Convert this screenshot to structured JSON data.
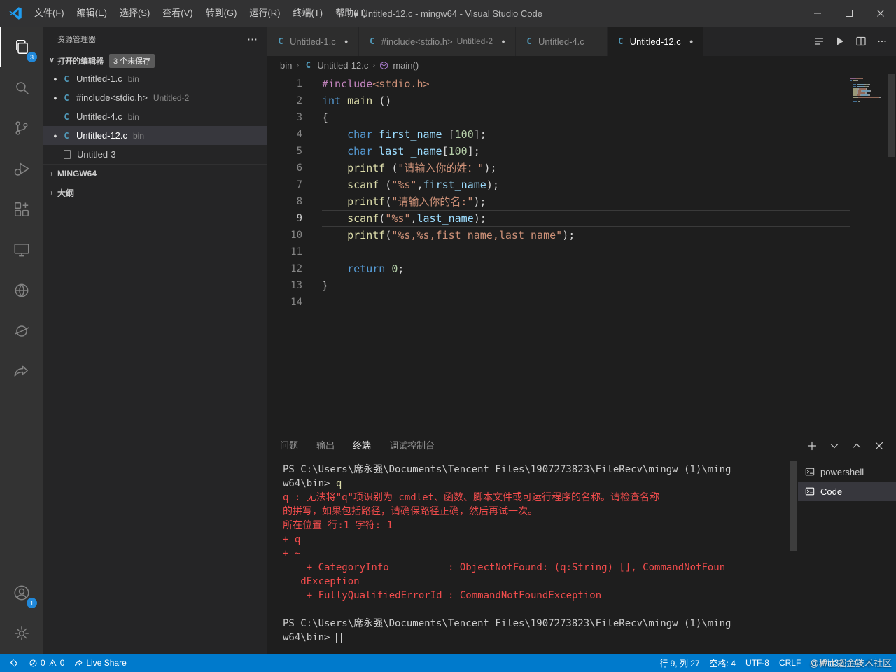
{
  "titlebar": {
    "menus": [
      "文件(F)",
      "编辑(E)",
      "选择(S)",
      "查看(V)",
      "转到(G)",
      "运行(R)",
      "终端(T)",
      "帮助(H)"
    ],
    "title": "● Untitled-12.c - mingw64 - Visual Studio Code"
  },
  "activity": {
    "explorer_badge": "3",
    "account_badge": "1"
  },
  "icons": {
    "modified_dot": "●",
    "chevron_down": "∨",
    "chevron_right": "›",
    "ellipsis": "⋯",
    "c_file": "C"
  },
  "sidebar": {
    "header": "资源管理器",
    "open_editors": {
      "label": "打开的编辑器",
      "badge": "3 个未保存"
    },
    "files": [
      {
        "modified": true,
        "icon": "c",
        "name": "Untitled-1.c",
        "detail": "bin",
        "selected": false
      },
      {
        "modified": true,
        "icon": "c",
        "name": "#include<stdio.h>",
        "detail": "Untitled-2",
        "selected": false
      },
      {
        "modified": false,
        "icon": "c",
        "name": "Untitled-4.c",
        "detail": "bin",
        "selected": false
      },
      {
        "modified": true,
        "icon": "c",
        "name": "Untitled-12.c",
        "detail": "bin",
        "selected": true
      },
      {
        "modified": false,
        "icon": "file",
        "name": "Untitled-3",
        "detail": "",
        "selected": false
      }
    ],
    "sections": [
      {
        "label": "MINGW64"
      },
      {
        "label": "大纲"
      }
    ]
  },
  "tabs": [
    {
      "label": "Untitled-1.c",
      "detail": "",
      "modified": true,
      "active": false
    },
    {
      "label": "#include<stdio.h>",
      "detail": "Untitled-2",
      "modified": true,
      "active": false
    },
    {
      "label": "Untitled-4.c",
      "detail": "",
      "modified": false,
      "active": false
    },
    {
      "label": "Untitled-12.c",
      "detail": "",
      "modified": true,
      "active": true
    }
  ],
  "breadcrumb": {
    "items": [
      "bin",
      "Untitled-12.c",
      "main()"
    ]
  },
  "editor": {
    "current_line": 9,
    "lines": [
      {
        "n": 1,
        "tokens": [
          {
            "t": "#include",
            "c": "inc"
          },
          {
            "t": "<stdio.h>",
            "c": "str"
          }
        ]
      },
      {
        "n": 2,
        "tokens": [
          {
            "t": "int",
            "c": "kw"
          },
          {
            "t": " ",
            "c": "pln"
          },
          {
            "t": "main",
            "c": "fn"
          },
          {
            "t": " ()",
            "c": "pln"
          }
        ]
      },
      {
        "n": 3,
        "tokens": [
          {
            "t": "{",
            "c": "pln"
          }
        ]
      },
      {
        "n": 4,
        "tokens": [
          {
            "t": "    ",
            "c": "pln"
          },
          {
            "t": "char",
            "c": "kw"
          },
          {
            "t": " ",
            "c": "pln"
          },
          {
            "t": "first_name",
            "c": "var"
          },
          {
            "t": " [",
            "c": "pln"
          },
          {
            "t": "100",
            "c": "num"
          },
          {
            "t": "];",
            "c": "pln"
          }
        ]
      },
      {
        "n": 5,
        "tokens": [
          {
            "t": "    ",
            "c": "pln"
          },
          {
            "t": "char",
            "c": "kw"
          },
          {
            "t": " ",
            "c": "pln"
          },
          {
            "t": "last",
            "c": "var"
          },
          {
            "t": " ",
            "c": "pln"
          },
          {
            "t": "_name",
            "c": "var"
          },
          {
            "t": "[",
            "c": "pln"
          },
          {
            "t": "100",
            "c": "num"
          },
          {
            "t": "];",
            "c": "pln"
          }
        ]
      },
      {
        "n": 6,
        "tokens": [
          {
            "t": "    ",
            "c": "pln"
          },
          {
            "t": "printf",
            "c": "fn"
          },
          {
            "t": " (",
            "c": "pln"
          },
          {
            "t": "\"请输入你的姓：\"",
            "c": "str"
          },
          {
            "t": ");",
            "c": "pln"
          }
        ]
      },
      {
        "n": 7,
        "tokens": [
          {
            "t": "    ",
            "c": "pln"
          },
          {
            "t": "scanf",
            "c": "fn"
          },
          {
            "t": " (",
            "c": "pln"
          },
          {
            "t": "\"%s\"",
            "c": "str"
          },
          {
            "t": ",",
            "c": "pln"
          },
          {
            "t": "first_name",
            "c": "var"
          },
          {
            "t": ");",
            "c": "pln"
          }
        ]
      },
      {
        "n": 8,
        "tokens": [
          {
            "t": "    ",
            "c": "pln"
          },
          {
            "t": "printf",
            "c": "fn"
          },
          {
            "t": "(",
            "c": "pln"
          },
          {
            "t": "\"请输入你的名:\"",
            "c": "str"
          },
          {
            "t": ");",
            "c": "pln"
          }
        ]
      },
      {
        "n": 9,
        "tokens": [
          {
            "t": "    ",
            "c": "pln"
          },
          {
            "t": "scanf",
            "c": "fn"
          },
          {
            "t": "(",
            "c": "pln"
          },
          {
            "t": "\"%s\"",
            "c": "str"
          },
          {
            "t": ",",
            "c": "pln"
          },
          {
            "t": "last_name",
            "c": "var"
          },
          {
            "t": ");",
            "c": "pln"
          }
        ]
      },
      {
        "n": 10,
        "tokens": [
          {
            "t": "    ",
            "c": "pln"
          },
          {
            "t": "printf",
            "c": "fn"
          },
          {
            "t": "(",
            "c": "pln"
          },
          {
            "t": "\"%s,%s,fist_name,last_name\"",
            "c": "str"
          },
          {
            "t": ");",
            "c": "pln"
          }
        ]
      },
      {
        "n": 11,
        "tokens": []
      },
      {
        "n": 12,
        "tokens": [
          {
            "t": "    ",
            "c": "pln"
          },
          {
            "t": "return",
            "c": "kw"
          },
          {
            "t": " ",
            "c": "pln"
          },
          {
            "t": "0",
            "c": "num"
          },
          {
            "t": ";",
            "c": "pln"
          }
        ]
      },
      {
        "n": 13,
        "tokens": [
          {
            "t": "}",
            "c": "pln"
          }
        ]
      },
      {
        "n": 14,
        "tokens": []
      }
    ]
  },
  "panel": {
    "tabs": [
      {
        "label": "问题",
        "active": false
      },
      {
        "label": "输出",
        "active": false
      },
      {
        "label": "终端",
        "active": true
      },
      {
        "label": "调试控制台",
        "active": false
      }
    ],
    "terminal": {
      "lines": [
        {
          "segs": [
            {
              "t": "PS C:\\Users\\席永强\\Documents\\Tencent Files\\1907273823\\FileRecv\\mingw (1)\\ming",
              "c": "pln"
            }
          ]
        },
        {
          "segs": [
            {
              "t": "w64\\bin> ",
              "c": "pln"
            },
            {
              "t": "q",
              "c": "cmd"
            }
          ]
        },
        {
          "segs": [
            {
              "t": "q : 无法将\"q\"项识别为 cmdlet、函数、脚本文件或可运行程序的名称。请检查名称",
              "c": "err"
            }
          ]
        },
        {
          "segs": [
            {
              "t": "的拼写，如果包括路径，请确保路径正确，然后再试一次。",
              "c": "err"
            }
          ]
        },
        {
          "segs": [
            {
              "t": "所在位置 行:1 字符: 1",
              "c": "err"
            }
          ]
        },
        {
          "segs": [
            {
              "t": "+ q",
              "c": "err"
            }
          ]
        },
        {
          "segs": [
            {
              "t": "+ ~",
              "c": "err"
            }
          ]
        },
        {
          "segs": [
            {
              "t": "    + CategoryInfo          : ObjectNotFound: (q:String) [], CommandNotFoun",
              "c": "err"
            }
          ]
        },
        {
          "segs": [
            {
              "t": "   dException",
              "c": "err"
            }
          ]
        },
        {
          "segs": [
            {
              "t": "    + FullyQualifiedErrorId : CommandNotFoundException",
              "c": "err"
            }
          ]
        },
        {
          "segs": []
        },
        {
          "segs": [
            {
              "t": "PS C:\\Users\\席永强\\Documents\\Tencent Files\\1907273823\\FileRecv\\mingw (1)\\ming",
              "c": "pln"
            }
          ]
        },
        {
          "segs": [
            {
              "t": "w64\\bin> ",
              "c": "pln"
            },
            {
              "t": "",
              "c": "cursor"
            }
          ]
        }
      ]
    },
    "sessions": [
      {
        "label": "powershell",
        "active": false
      },
      {
        "label": "Code",
        "active": true
      }
    ]
  },
  "statusbar": {
    "errors": "0",
    "warnings": "0",
    "live_share": "Live Share",
    "line_col": "行 9, 列 27",
    "spaces": "空格: 4",
    "encoding": "UTF-8",
    "eol": "CRLF",
    "language": "C",
    "config": "Win32"
  },
  "watermark": "@稀土掘金技术社区"
}
